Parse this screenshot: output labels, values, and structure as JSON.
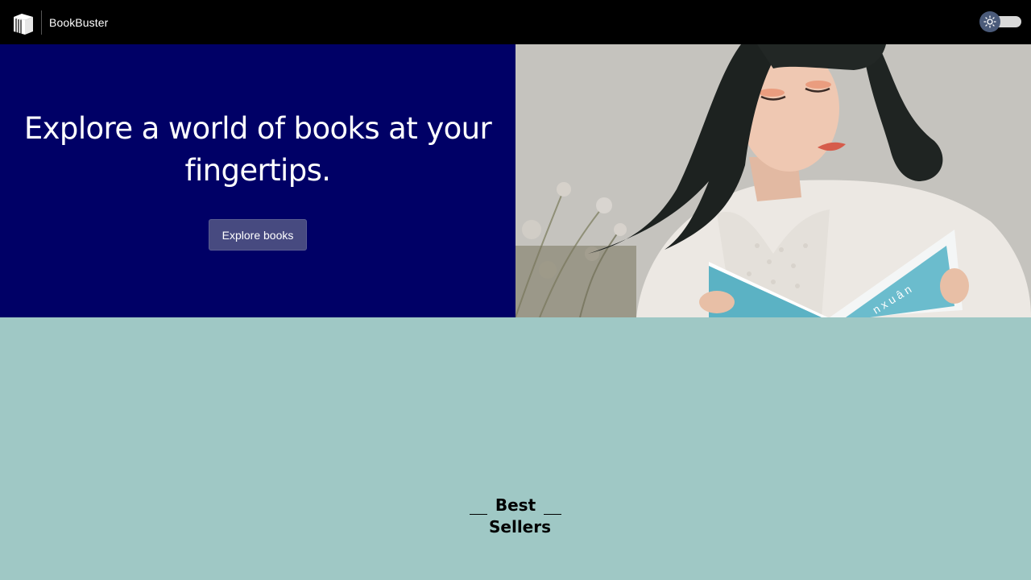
{
  "navbar": {
    "brand": "BookBuster",
    "logo_icon": "books-logo-icon",
    "theme_toggle_icon": "sun-icon"
  },
  "hero": {
    "headline": "Explore a world of books at your fingertips.",
    "cta_label": "Explore books",
    "background_color": "#000066",
    "image_description_icon": "woman-reading-book-photo"
  },
  "bestsellers": {
    "heading": "Best Sellers",
    "background_color": "#9fc8c5"
  }
}
